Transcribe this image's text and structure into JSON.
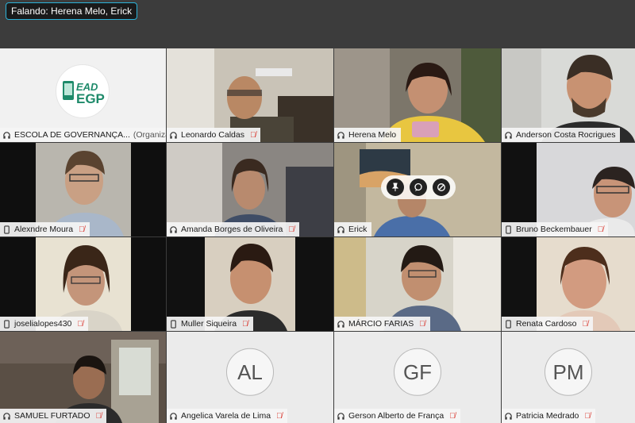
{
  "speaking_indicator": "Falando: Herena Melo, Erick",
  "participants": [
    {
      "name": "ESCOLA DE GOVERNANÇA...",
      "role": "(Organizador...)",
      "muted": false,
      "logo_text": "EAD EGP"
    },
    {
      "name": "Leonardo Caldas",
      "muted": true
    },
    {
      "name": "Herena Melo",
      "muted": false,
      "speaking": true
    },
    {
      "name": "Anderson Costa Rocrigues",
      "muted": false
    },
    {
      "name": "Alexndre Moura",
      "muted": true
    },
    {
      "name": "Amanda Borges de Oliveira",
      "muted": true
    },
    {
      "name": "Erick",
      "muted": false,
      "speaking": true
    },
    {
      "name": "Bruno Beckembauer",
      "muted": true
    },
    {
      "name": "joselialopes430",
      "muted": true
    },
    {
      "name": "Muller Siqueira",
      "muted": true
    },
    {
      "name": "MÁRCIO FARIAS",
      "muted": true
    },
    {
      "name": "Renata Cardoso",
      "muted": true
    },
    {
      "name": "SAMUEL FURTADO",
      "muted": true
    },
    {
      "name": "Angelica Varela de Lima",
      "muted": true,
      "initials": "AL"
    },
    {
      "name": "Gerson Alberto de França",
      "muted": true,
      "initials": "GF"
    },
    {
      "name": "Patricia Medrado",
      "muted": true,
      "initials": "PM"
    }
  ],
  "colors": {
    "accent": "#2bb3d9",
    "muted": "#d9342b",
    "topbar": "#3c3c3c"
  },
  "icons": {
    "audio": "headset-icon",
    "muted": "mic-off-icon",
    "device": "phone-icon"
  }
}
